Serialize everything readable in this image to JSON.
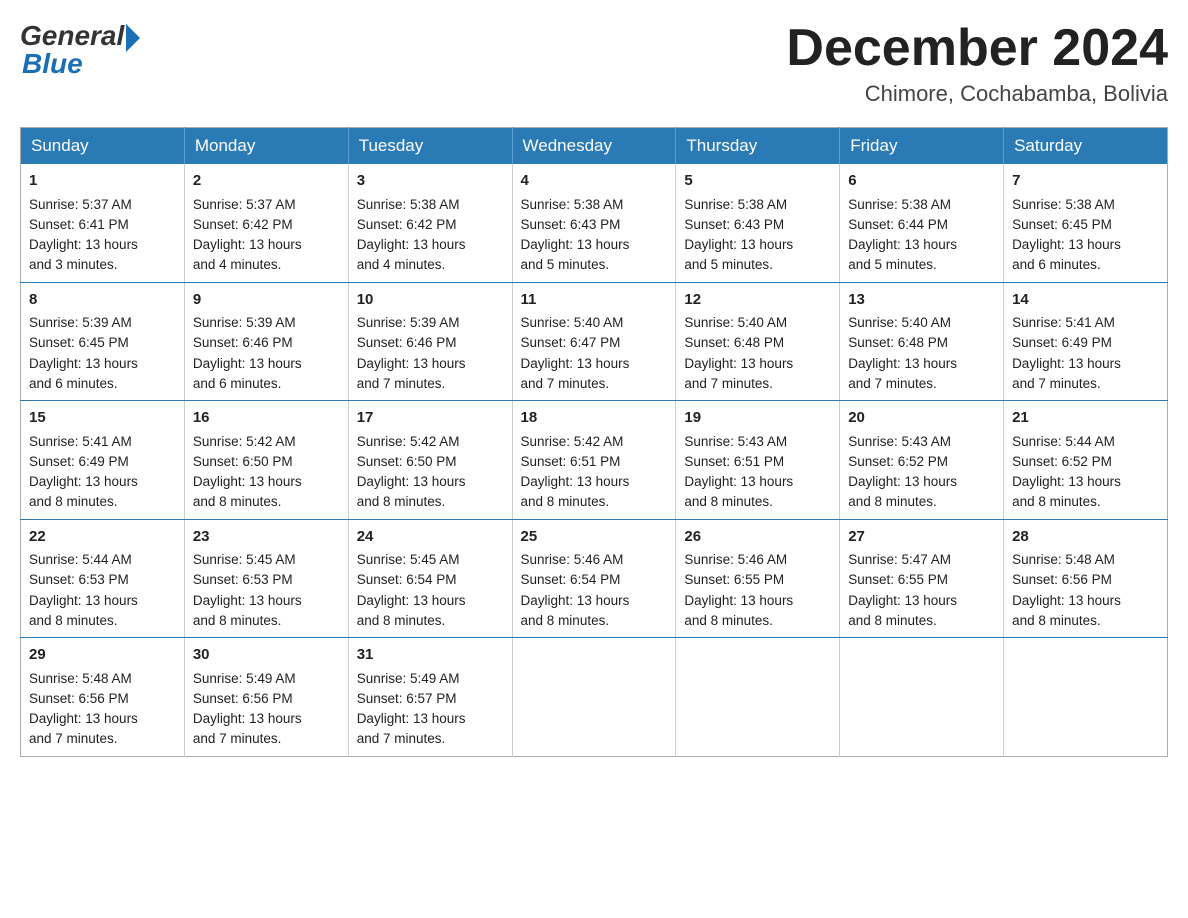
{
  "logo": {
    "general": "General",
    "blue": "Blue"
  },
  "title": "December 2024",
  "subtitle": "Chimore, Cochabamba, Bolivia",
  "days_of_week": [
    "Sunday",
    "Monday",
    "Tuesday",
    "Wednesday",
    "Thursday",
    "Friday",
    "Saturday"
  ],
  "weeks": [
    [
      {
        "day": "1",
        "sunrise": "5:37 AM",
        "sunset": "6:41 PM",
        "daylight": "13 hours and 3 minutes."
      },
      {
        "day": "2",
        "sunrise": "5:37 AM",
        "sunset": "6:42 PM",
        "daylight": "13 hours and 4 minutes."
      },
      {
        "day": "3",
        "sunrise": "5:38 AM",
        "sunset": "6:42 PM",
        "daylight": "13 hours and 4 minutes."
      },
      {
        "day": "4",
        "sunrise": "5:38 AM",
        "sunset": "6:43 PM",
        "daylight": "13 hours and 5 minutes."
      },
      {
        "day": "5",
        "sunrise": "5:38 AM",
        "sunset": "6:43 PM",
        "daylight": "13 hours and 5 minutes."
      },
      {
        "day": "6",
        "sunrise": "5:38 AM",
        "sunset": "6:44 PM",
        "daylight": "13 hours and 5 minutes."
      },
      {
        "day": "7",
        "sunrise": "5:38 AM",
        "sunset": "6:45 PM",
        "daylight": "13 hours and 6 minutes."
      }
    ],
    [
      {
        "day": "8",
        "sunrise": "5:39 AM",
        "sunset": "6:45 PM",
        "daylight": "13 hours and 6 minutes."
      },
      {
        "day": "9",
        "sunrise": "5:39 AM",
        "sunset": "6:46 PM",
        "daylight": "13 hours and 6 minutes."
      },
      {
        "day": "10",
        "sunrise": "5:39 AM",
        "sunset": "6:46 PM",
        "daylight": "13 hours and 7 minutes."
      },
      {
        "day": "11",
        "sunrise": "5:40 AM",
        "sunset": "6:47 PM",
        "daylight": "13 hours and 7 minutes."
      },
      {
        "day": "12",
        "sunrise": "5:40 AM",
        "sunset": "6:48 PM",
        "daylight": "13 hours and 7 minutes."
      },
      {
        "day": "13",
        "sunrise": "5:40 AM",
        "sunset": "6:48 PM",
        "daylight": "13 hours and 7 minutes."
      },
      {
        "day": "14",
        "sunrise": "5:41 AM",
        "sunset": "6:49 PM",
        "daylight": "13 hours and 7 minutes."
      }
    ],
    [
      {
        "day": "15",
        "sunrise": "5:41 AM",
        "sunset": "6:49 PM",
        "daylight": "13 hours and 8 minutes."
      },
      {
        "day": "16",
        "sunrise": "5:42 AM",
        "sunset": "6:50 PM",
        "daylight": "13 hours and 8 minutes."
      },
      {
        "day": "17",
        "sunrise": "5:42 AM",
        "sunset": "6:50 PM",
        "daylight": "13 hours and 8 minutes."
      },
      {
        "day": "18",
        "sunrise": "5:42 AM",
        "sunset": "6:51 PM",
        "daylight": "13 hours and 8 minutes."
      },
      {
        "day": "19",
        "sunrise": "5:43 AM",
        "sunset": "6:51 PM",
        "daylight": "13 hours and 8 minutes."
      },
      {
        "day": "20",
        "sunrise": "5:43 AM",
        "sunset": "6:52 PM",
        "daylight": "13 hours and 8 minutes."
      },
      {
        "day": "21",
        "sunrise": "5:44 AM",
        "sunset": "6:52 PM",
        "daylight": "13 hours and 8 minutes."
      }
    ],
    [
      {
        "day": "22",
        "sunrise": "5:44 AM",
        "sunset": "6:53 PM",
        "daylight": "13 hours and 8 minutes."
      },
      {
        "day": "23",
        "sunrise": "5:45 AM",
        "sunset": "6:53 PM",
        "daylight": "13 hours and 8 minutes."
      },
      {
        "day": "24",
        "sunrise": "5:45 AM",
        "sunset": "6:54 PM",
        "daylight": "13 hours and 8 minutes."
      },
      {
        "day": "25",
        "sunrise": "5:46 AM",
        "sunset": "6:54 PM",
        "daylight": "13 hours and 8 minutes."
      },
      {
        "day": "26",
        "sunrise": "5:46 AM",
        "sunset": "6:55 PM",
        "daylight": "13 hours and 8 minutes."
      },
      {
        "day": "27",
        "sunrise": "5:47 AM",
        "sunset": "6:55 PM",
        "daylight": "13 hours and 8 minutes."
      },
      {
        "day": "28",
        "sunrise": "5:48 AM",
        "sunset": "6:56 PM",
        "daylight": "13 hours and 8 minutes."
      }
    ],
    [
      {
        "day": "29",
        "sunrise": "5:48 AM",
        "sunset": "6:56 PM",
        "daylight": "13 hours and 7 minutes."
      },
      {
        "day": "30",
        "sunrise": "5:49 AM",
        "sunset": "6:56 PM",
        "daylight": "13 hours and 7 minutes."
      },
      {
        "day": "31",
        "sunrise": "5:49 AM",
        "sunset": "6:57 PM",
        "daylight": "13 hours and 7 minutes."
      },
      null,
      null,
      null,
      null
    ]
  ],
  "labels": {
    "sunrise": "Sunrise:",
    "sunset": "Sunset:",
    "daylight": "Daylight:"
  }
}
